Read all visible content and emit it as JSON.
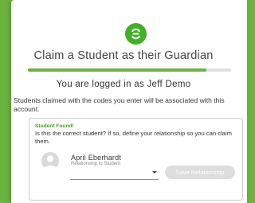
{
  "header": {
    "title": "Claim a Student as their Guardian",
    "progress_value": 0.88
  },
  "account": {
    "logged_in_text": "You are logged in as Jeff Demo",
    "description": "Students claimed with the codes you enter will be associated with this account."
  },
  "student_found": {
    "heading": "Student Found!",
    "question": "Is this the correct student? If so, define your relationship so you can claim them.",
    "student_name": "April Eberhardt",
    "relationship_label": "Relationship to Student",
    "relationship_value": "",
    "save_label": "Save Relationship"
  },
  "colors": {
    "brand_green": "#6db33f",
    "logo_green": "#43b02a",
    "found_green": "#43a02a",
    "disabled_button": "#dddddd"
  },
  "icons": {
    "logo": "classlink-logo-icon",
    "avatar": "user-avatar-placeholder-icon",
    "select_arrow": "chevron-down-icon"
  }
}
